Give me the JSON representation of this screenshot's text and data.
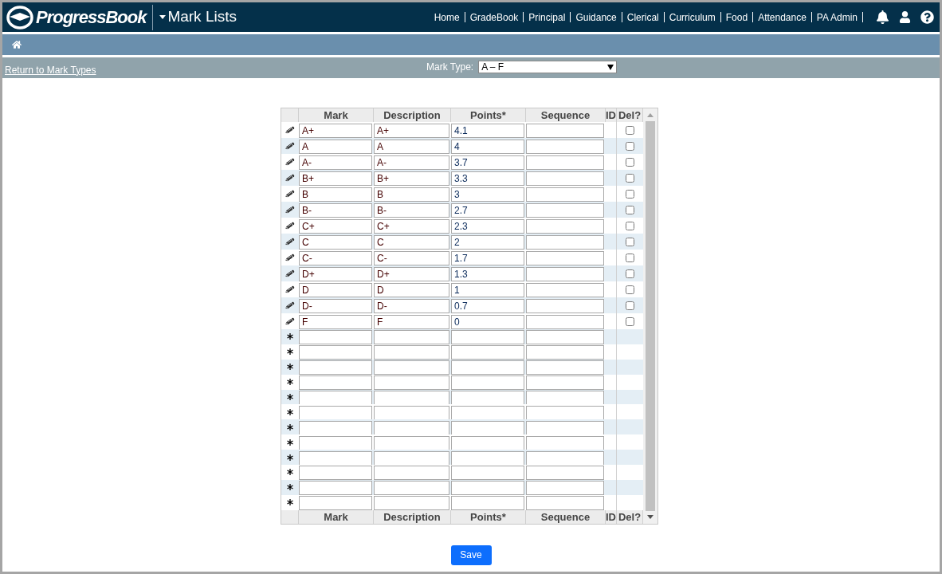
{
  "header": {
    "logo": "ProgressBook",
    "title": "Mark Lists",
    "nav": [
      "Home",
      "GradeBook",
      "Principal",
      "Guidance",
      "Clerical",
      "Curriculum",
      "Food",
      "Attendance",
      "PA Admin"
    ]
  },
  "toolbar": {
    "back_link": "Return to Mark Types",
    "mark_type_label": "Mark Type:",
    "mark_type_value": "A – F"
  },
  "table": {
    "columns": [
      "Mark",
      "Description",
      "Points*",
      "Sequence",
      "ID",
      "Del?"
    ],
    "footer_columns": [
      "Mark",
      "Description",
      "Points*",
      "Sequence",
      "ID",
      "Del?"
    ],
    "rows": [
      {
        "kind": "existing",
        "mark": "A+",
        "description": "A+",
        "points": "4.1",
        "checked": false
      },
      {
        "kind": "existing",
        "mark": "A",
        "description": "A",
        "points": "4",
        "checked": false
      },
      {
        "kind": "existing",
        "mark": "A-",
        "description": "A-",
        "points": "3.7",
        "checked": false
      },
      {
        "kind": "existing",
        "mark": "B+",
        "description": "B+",
        "points": "3.3",
        "checked": false
      },
      {
        "kind": "existing",
        "mark": "B",
        "description": "B",
        "points": "3",
        "checked": false
      },
      {
        "kind": "existing",
        "mark": "B-",
        "description": "B-",
        "points": "2.7",
        "checked": false
      },
      {
        "kind": "existing",
        "mark": "C+",
        "description": "C+",
        "points": "2.3",
        "checked": false
      },
      {
        "kind": "existing",
        "mark": "C",
        "description": "C",
        "points": "2",
        "checked": false
      },
      {
        "kind": "existing",
        "mark": "C-",
        "description": "C-",
        "points": "1.7",
        "checked": false
      },
      {
        "kind": "existing",
        "mark": "D+",
        "description": "D+",
        "points": "1.3",
        "checked": false
      },
      {
        "kind": "existing",
        "mark": "D",
        "description": "D",
        "points": "1",
        "checked": false
      },
      {
        "kind": "existing",
        "mark": "D-",
        "description": "D-",
        "points": "0.7",
        "checked": false
      },
      {
        "kind": "existing",
        "mark": "F",
        "description": "F",
        "points": "0",
        "checked": false
      },
      {
        "kind": "new"
      },
      {
        "kind": "new"
      },
      {
        "kind": "new"
      },
      {
        "kind": "new"
      },
      {
        "kind": "new"
      },
      {
        "kind": "new"
      },
      {
        "kind": "new"
      },
      {
        "kind": "new"
      },
      {
        "kind": "new"
      },
      {
        "kind": "new"
      },
      {
        "kind": "new"
      },
      {
        "kind": "new"
      }
    ]
  },
  "save_button": "Save"
}
